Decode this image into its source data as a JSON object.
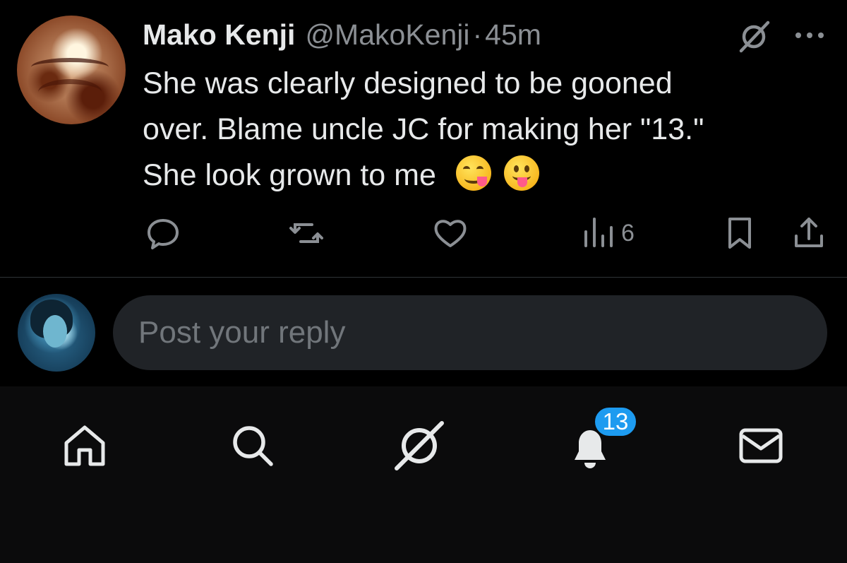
{
  "tweet": {
    "author_name": "Mako Kenji",
    "author_handle": "@MakoKenji",
    "separator": "·",
    "time": "45m",
    "text_line1": "She was clearly designed to be gooned",
    "text_line2": "over. Blame uncle JC for making her \"13.\"",
    "text_line3": "She look grown to me",
    "emojis": [
      "face-savoring-food-emoji",
      "face-with-tongue-emoji"
    ],
    "views": "6"
  },
  "reply": {
    "placeholder": "Post your reply"
  },
  "tabbar": {
    "items": [
      "home-icon",
      "search-icon",
      "grok-icon",
      "notifications-icon",
      "messages-icon"
    ],
    "notifications_badge": "13"
  },
  "colors": {
    "background": "#000000",
    "text": "#e7e9ea",
    "muted": "#8b8f94",
    "accent": "#1d9bf0",
    "input_bg": "#202327"
  }
}
